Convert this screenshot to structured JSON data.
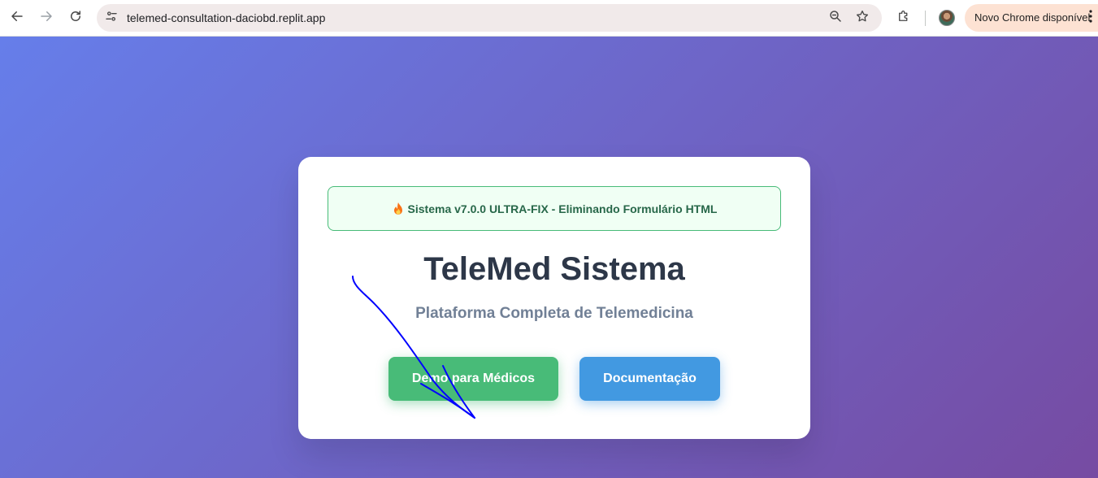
{
  "browser": {
    "url": "telemed-consultation-daciobd.replit.app",
    "update_label": "Novo Chrome disponível",
    "icons": {
      "back": "arrow-left-icon",
      "forward": "arrow-right-icon",
      "reload": "reload-icon",
      "site_info": "tune-icon",
      "zoom": "zoom-icon",
      "bookmark": "star-icon",
      "extensions": "puzzle-icon",
      "menu": "kebab-menu-icon"
    }
  },
  "page": {
    "banner": {
      "icon": "fire-emoji-icon",
      "text": "Sistema v7.0.0 ULTRA-FIX - Eliminando Formulário HTML"
    },
    "title": "TeleMed Sistema",
    "subtitle": "Plataforma Completa de Telemedicina",
    "buttons": {
      "demo": "Demo para Médicos",
      "docs": "Documentação"
    },
    "colors": {
      "gradient_start": "#667eea",
      "gradient_end": "#764ba2",
      "demo_button": "#48bb78",
      "docs_button": "#4299e1",
      "banner_bg": "#f0fff4",
      "banner_border": "#48bb78",
      "banner_text": "#276749",
      "title": "#2d3748",
      "subtitle": "#718096",
      "annotation_stroke": "#0000ff"
    }
  }
}
